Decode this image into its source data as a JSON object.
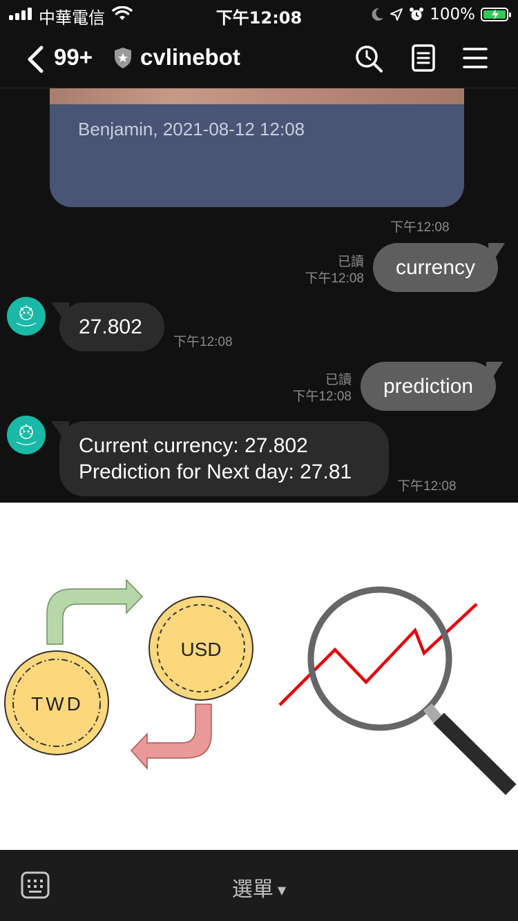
{
  "status_bar": {
    "carrier": "中華電信",
    "time": "下午12:08",
    "battery_percent": "100%"
  },
  "header": {
    "back_count": "99+",
    "title": "cvlinebot"
  },
  "chat": {
    "image_caption": "Benjamin, 2021-08-12 12:08",
    "image_time": "下午12:08",
    "messages": [
      {
        "direction": "out",
        "text": "currency",
        "read_label": "已讀",
        "time": "下午12:08"
      },
      {
        "direction": "in",
        "text": "27.802",
        "time": "下午12:08"
      },
      {
        "direction": "out",
        "text": "prediction",
        "read_label": "已讀",
        "time": "下午12:08"
      },
      {
        "direction": "in",
        "lines": [
          "Current currency: 27.802",
          "Prediction for Next day: 27.81"
        ],
        "time": "下午12:08"
      }
    ]
  },
  "rich_menu": {
    "left": {
      "icon": "currency-exchange-icon",
      "coin1": "TWD",
      "coin2": "USD"
    },
    "right": {
      "icon": "trend-magnifier-icon"
    }
  },
  "bottom_bar": {
    "menu_label": "選單"
  },
  "colors": {
    "background": "#111111",
    "incoming_bubble": "#2b2b2b",
    "outgoing_bubble": "#5e5e5e",
    "image_card": "#4a5474",
    "avatar": "#1ab8a6",
    "battery": "#33c759",
    "coin": "#fcd77c",
    "trend_line": "#e8000b"
  }
}
